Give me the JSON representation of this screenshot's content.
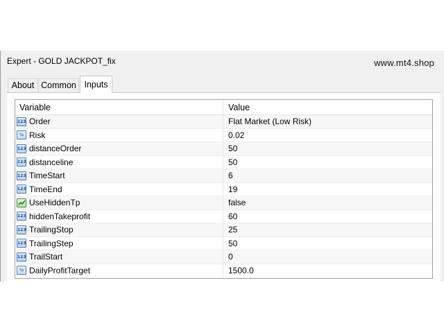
{
  "window": {
    "title": "Expert - GOLD JACKPOT_fix",
    "watermark": "www.mt4.shop"
  },
  "tabs": [
    {
      "label": "About",
      "active": false
    },
    {
      "label": "Common",
      "active": false
    },
    {
      "label": "Inputs",
      "active": true
    }
  ],
  "table": {
    "headers": {
      "variable": "Variable",
      "value": "Value"
    },
    "rows": [
      {
        "variable": "Order",
        "value": "Flat Market (Low Risk)",
        "icon": "integer-type-icon"
      },
      {
        "variable": "Risk",
        "value": "0.02",
        "icon": "double-type-icon"
      },
      {
        "variable": "distanceOrder",
        "value": "50",
        "icon": "integer-type-icon"
      },
      {
        "variable": "distanceline",
        "value": "50",
        "icon": "integer-type-icon"
      },
      {
        "variable": "TimeStart",
        "value": "6",
        "icon": "integer-type-icon"
      },
      {
        "variable": "TimeEnd",
        "value": "19",
        "icon": "integer-type-icon"
      },
      {
        "variable": "UseHiddenTp",
        "value": "false",
        "icon": "boolean-type-icon"
      },
      {
        "variable": "hiddenTakeprofit",
        "value": "60",
        "icon": "integer-type-icon"
      },
      {
        "variable": "TrailingStop",
        "value": "25",
        "icon": "integer-type-icon"
      },
      {
        "variable": "TrailingStep",
        "value": "50",
        "icon": "integer-type-icon"
      },
      {
        "variable": "TrailStart",
        "value": "0",
        "icon": "integer-type-icon"
      },
      {
        "variable": "DailyProfitTarget",
        "value": "1500.0",
        "icon": "double-type-icon"
      }
    ]
  },
  "icons": {
    "integer_glyph": "123",
    "double_glyph": "½"
  },
  "colors": {
    "window_bg": "#f0f0f0",
    "grid_border": "#a0a0a0",
    "alt_row": "#f7f7f7"
  }
}
